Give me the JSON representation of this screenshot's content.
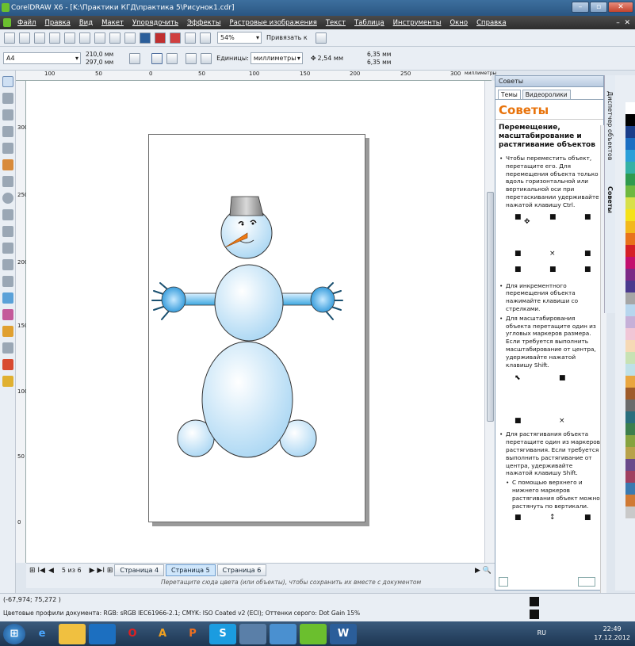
{
  "window": {
    "title": "CorelDRAW X6 - [K:\\Практики КГД\\практика 5\\Рисунок1.cdr]"
  },
  "menu": [
    "Файл",
    "Правка",
    "Вид",
    "Макет",
    "Упорядочить",
    "Эффекты",
    "Растровые изображения",
    "Текст",
    "Таблица",
    "Инструменты",
    "Окно",
    "Справка"
  ],
  "toolbar1": {
    "zoom": "54%",
    "snap": "Привязать к"
  },
  "toolbar2": {
    "page_size": "A4",
    "width": "210,0 мм",
    "height": "297,0 мм",
    "units_label": "Единицы:",
    "units": "миллиметры",
    "nudge": "2,54 мм",
    "dup_x": "6,35 мм",
    "dup_y": "6,35 мм"
  },
  "ruler": {
    "h_ticks": [
      "100",
      "50",
      "0",
      "50",
      "100",
      "150",
      "200",
      "250",
      "300"
    ],
    "unit": "миллиметры",
    "v_ticks": [
      "300",
      "250",
      "200",
      "150",
      "100",
      "50",
      "0"
    ],
    "v_unit": "миллиметры"
  },
  "pages": {
    "counter": "5 из 6",
    "tabs": [
      "Страница 4",
      "Страница 5",
      "Страница 6"
    ],
    "active": "Страница 5"
  },
  "hint": "Перетащите сюда цвета (или объекты), чтобы сохранить их вместе с документом",
  "status": {
    "coords": "(-67,974; 75,272 )",
    "profiles": "Цветовые профили документа: RGB: sRGB IEC61966-2.1; CMYK: ISO Coated v2 (ECI); Оттенки серого: Dot Gain 15%"
  },
  "docker": {
    "header": "Советы",
    "tabs": [
      "Темы",
      "Видеоролики"
    ],
    "title": "Советы",
    "heading": "Перемещение, масштабирование и растягивание объектов",
    "tip1": "Чтобы переместить объект, перетащите его. Для перемещения объекта только вдоль горизонтальной или вертикальной оси при перетаскивании удерживайте нажатой клавишу Ctrl.",
    "tip2": "Для инкрементного перемещения объекта нажимайте клавиши со стрелками.",
    "tip3": "Для масштабирования объекта перетащите один из угловых маркеров размера. Если требуется выполнить масштабирование от центра, удерживайте нажатой клавишу Shift.",
    "tip4": "Для растягивания объекта перетащите один из маркеров растягивания. Если требуется выполнить растягивание от центра, удерживайте нажатой клавишу Shift.",
    "tip5": "С помощью верхнего и нижнего маркеров растягивания объект можно растянуть по вертикали."
  },
  "side_tabs": [
    "Диспетчер объектов",
    "Советы"
  ],
  "palette": [
    "#ffffff",
    "#000000",
    "#1a3e8a",
    "#1b6fc2",
    "#2b9fd8",
    "#35b1a4",
    "#2f9a4e",
    "#6fb83f",
    "#d8e04a",
    "#f5e21a",
    "#f3b81b",
    "#e8731b",
    "#d52027",
    "#c3106e",
    "#7c2a86",
    "#4b3a8e",
    "#a6a6a6",
    "#b7d6ee",
    "#c6b0d8",
    "#f1c6d6",
    "#f6d9b5",
    "#c8e2b4",
    "#bfe1e8",
    "#e9a640",
    "#9e5b2a",
    "#6b6b6b",
    "#2a6f7d",
    "#3c7f4d",
    "#86a340",
    "#b8a24b",
    "#6a4a8a",
    "#a04060",
    "#3a7ab0",
    "#d07a34",
    "#c9c9c9"
  ],
  "taskbar": {
    "lang": "RU",
    "time": "22:49",
    "date": "17.12.2012"
  }
}
